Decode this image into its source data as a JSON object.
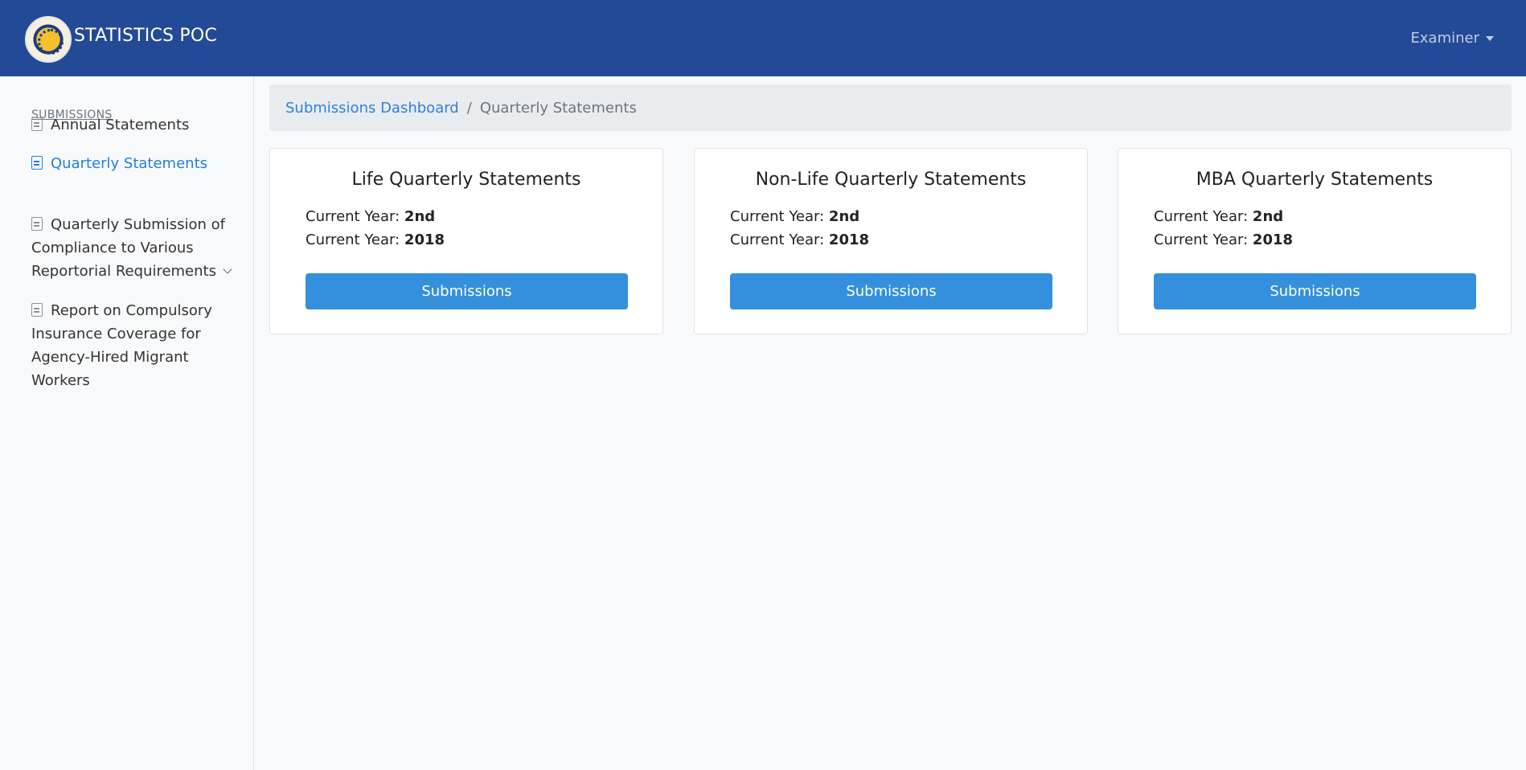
{
  "header": {
    "brand": "STATISTICS POC",
    "user_menu": "Examiner"
  },
  "sidebar": {
    "heading": "SUBMISSIONS",
    "items": [
      {
        "label": "Annual Statements"
      },
      {
        "label": "Quarterly Statements"
      },
      {
        "label": "Quarterly Submission of Compliance to Various Reportorial Requirements"
      },
      {
        "label": "Report on Compulsory Insurance Coverage for Agency-Hired Migrant Workers"
      }
    ]
  },
  "breadcrumb": {
    "link": "Submissions Dashboard",
    "separator": "/",
    "current": "Quarterly Statements"
  },
  "cards": [
    {
      "title": "Life Quarterly Statements",
      "line1_label": "Current Year:",
      "line1_value": "2nd",
      "line2_label": "Current Year:",
      "line2_value": "2018",
      "button": "Submissions"
    },
    {
      "title": "Non-Life Quarterly Statements",
      "line1_label": "Current Year:",
      "line1_value": "2nd",
      "line2_label": "Current Year:",
      "line2_value": "2018",
      "button": "Submissions"
    },
    {
      "title": "MBA Quarterly Statements",
      "line1_label": "Current Year:",
      "line1_value": "2nd",
      "line2_label": "Current Year:",
      "line2_value": "2018",
      "button": "Submissions"
    }
  ],
  "colors": {
    "header_bg": "#234a97",
    "accent": "#3490dc",
    "active_link": "#1f7fe0"
  }
}
